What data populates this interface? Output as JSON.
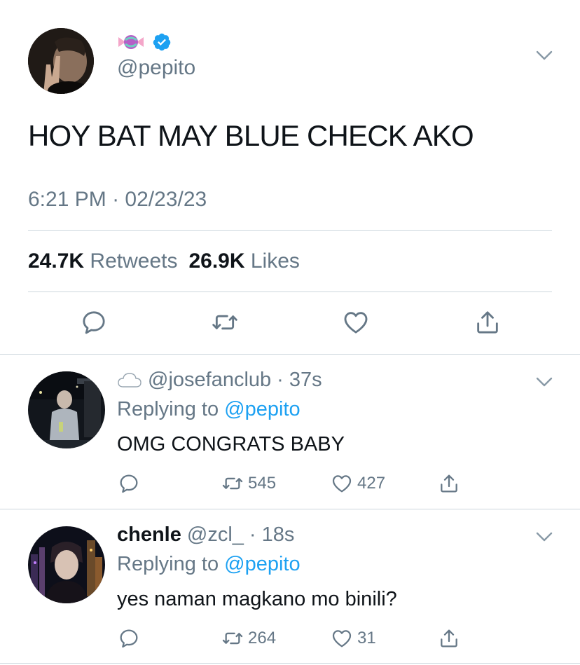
{
  "main_tweet": {
    "display_name_icon": "candy-emoji-icon",
    "verified_icon": "verified-badge-icon",
    "handle": "@pepito",
    "text": "HOY BAT MAY BLUE CHECK AKO",
    "time": "6:21 PM",
    "separator": "·",
    "date": "02/23/23",
    "retweets_count": "24.7K",
    "retweets_label": "Retweets",
    "likes_count": "26.9K",
    "likes_label": "Likes",
    "actions": [
      "reply-icon",
      "retweet-icon",
      "like-icon",
      "share-icon"
    ]
  },
  "replies": [
    {
      "name_icon": "cloud-emoji-icon",
      "display_name": "",
      "handle": "@josefanclub",
      "separator": "·",
      "age": "37s",
      "replying_prefix": "Replying to",
      "replying_to": "@pepito",
      "text": "OMG CONGRATS BABY",
      "retweets": "545",
      "likes": "427"
    },
    {
      "name_icon": "",
      "display_name": "chenle",
      "handle": "@zcl_",
      "separator": "·",
      "age": "18s",
      "replying_prefix": "Replying to",
      "replying_to": "@pepito",
      "text": "yes naman magkano mo binili?",
      "retweets": "264",
      "likes": "31"
    }
  ],
  "colors": {
    "text_primary": "#0f1419",
    "text_secondary": "#657786",
    "link": "#1da1f2",
    "verified": "#1da1f2",
    "divider": "#ccd6dd"
  }
}
